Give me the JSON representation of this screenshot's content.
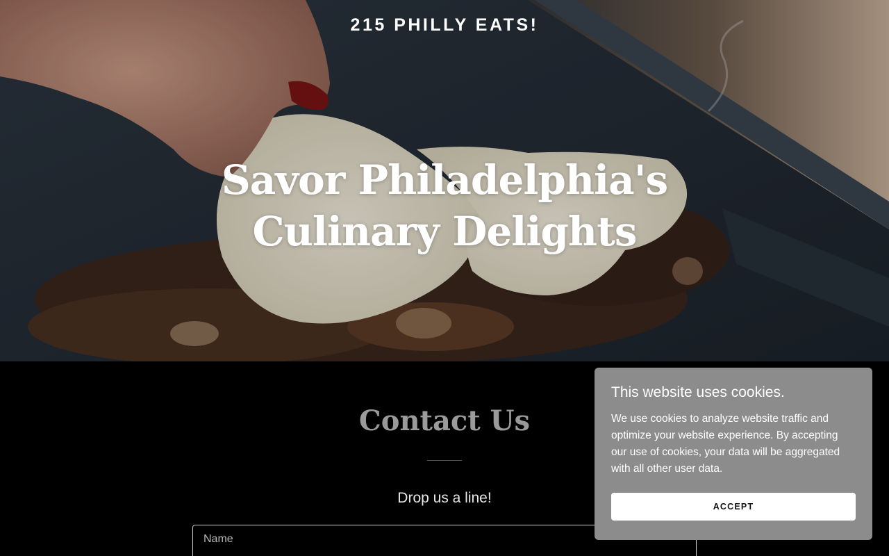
{
  "header": {
    "brand": "215 PHILLY EATS!"
  },
  "hero": {
    "headline": "Savor Philadelphia's Culinary Delights",
    "image_icon": "cheesesteak-grill-photo"
  },
  "contact": {
    "title": "Contact Us",
    "subtitle": "Drop us a line!",
    "name_placeholder": "Name"
  },
  "cookie_banner": {
    "title": "This website uses cookies.",
    "body": "We use cookies to analyze website traffic and optimize your website experience. By accepting our use of cookies, your data will be aggregated with all other user data.",
    "accept_label": "ACCEPT",
    "background_color": "#8c8c8c"
  }
}
